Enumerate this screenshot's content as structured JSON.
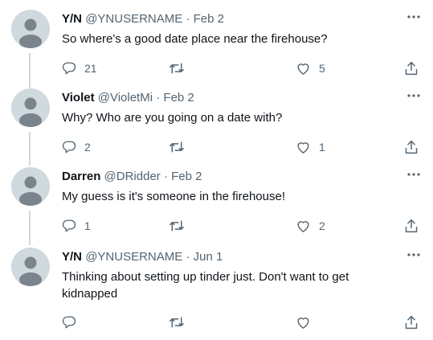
{
  "tweets": [
    {
      "name": "Y/N",
      "handle": "@YNUSERNAME",
      "separator": "·",
      "date": "Feb 2",
      "text": "So where's a good date place near the firehouse?",
      "reply_count": "21",
      "retweet_count": "",
      "like_count": "5"
    },
    {
      "name": "Violet",
      "handle": "@VioletMi",
      "separator": "·",
      "date": "Feb 2",
      "text": "Why? Who are you going on a date with?",
      "reply_count": "2",
      "retweet_count": "",
      "like_count": "1"
    },
    {
      "name": "Darren",
      "handle": "@DRidder",
      "separator": "·",
      "date": "Feb 2",
      "text": "My guess is it's someone in the firehouse!",
      "reply_count": "1",
      "retweet_count": "",
      "like_count": "2"
    },
    {
      "name": "Y/N",
      "handle": "@YNUSERNAME",
      "separator": "·",
      "date": "Jun 1",
      "text": "Thinking about setting up tinder just. Don't want to get kidnapped",
      "reply_count": "",
      "retweet_count": "",
      "like_count": ""
    }
  ],
  "icons": {
    "more": "more-icon",
    "reply": "reply-icon",
    "retweet": "retweet-icon",
    "like": "like-icon",
    "share": "share-icon"
  },
  "colors": {
    "text": "#0f1419",
    "secondary": "#536471",
    "avatar_bg": "#cfd9de",
    "avatar_fg": "#7b848d"
  }
}
